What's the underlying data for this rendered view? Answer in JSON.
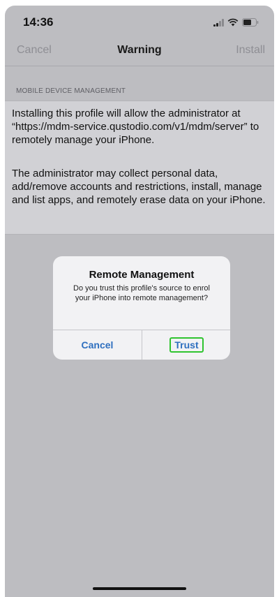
{
  "status_bar": {
    "time": "14:36",
    "icons": [
      "signal-icon",
      "wifi-icon",
      "battery-icon"
    ]
  },
  "nav_bar": {
    "cancel_label": "Cancel",
    "title": "Warning",
    "install_label": "Install"
  },
  "section": {
    "header": "MOBILE DEVICE MANAGEMENT",
    "paragraph_1": "Installing this profile will allow the administrator at “https://mdm-service.qustodio.com/v1/mdm/server” to remotely manage your iPhone.",
    "paragraph_2": "The administrator may collect personal data, add/remove accounts and restrictions, install, manage and list apps, and remotely erase data on your iPhone."
  },
  "alert": {
    "title": "Remote Management",
    "message": "Do you trust this profile's source to enrol your iPhone into remote management?",
    "cancel_label": "Cancel",
    "trust_label": "Trust"
  },
  "colors": {
    "screen_background": "#bdbdc1",
    "alert_background": "#f2f2f4",
    "button_blue": "#2e6fbf",
    "highlight_green": "#2fc42f"
  }
}
